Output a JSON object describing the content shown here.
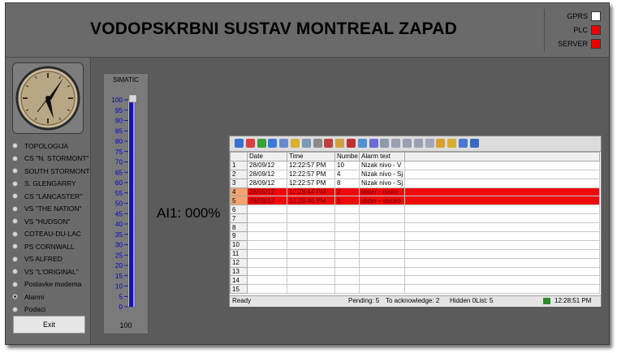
{
  "header": {
    "title": "VODOPSKRBNI SUSTAV MONTREAL ZAPAD"
  },
  "status": [
    {
      "label": "GPRS",
      "color": "#ffffff"
    },
    {
      "label": "PLC",
      "color": "#ee0000"
    },
    {
      "label": "SERVER",
      "color": "#ee0000"
    }
  ],
  "nav": {
    "items": [
      {
        "label": "TOPOLOGIJA",
        "selected": false
      },
      {
        "label": "CS \"N. STORMONT\"",
        "selected": false
      },
      {
        "label": "SOUTH STORMONT",
        "selected": false
      },
      {
        "label": "S. GLENGARRY",
        "selected": false
      },
      {
        "label": "CS \"LANCASTER\"",
        "selected": false
      },
      {
        "label": "VS \"THE NATION\"",
        "selected": false
      },
      {
        "label": "VS \"HUDSON\"",
        "selected": false
      },
      {
        "label": "COTEAU-DU-LAC",
        "selected": false
      },
      {
        "label": "PS CORNWALL",
        "selected": false
      },
      {
        "label": "VS ALFRED",
        "selected": false
      },
      {
        "label": "VS \"L'ORIGINAL\"",
        "selected": false
      },
      {
        "label": "Postavke modema",
        "selected": false
      },
      {
        "label": "Alarmi",
        "selected": true
      },
      {
        "label": "Podaci",
        "selected": false
      }
    ],
    "exit_label": "Exit"
  },
  "gauge": {
    "title": "SIMATIC",
    "ticks": [
      "100",
      "95",
      "90",
      "85",
      "80",
      "75",
      "70",
      "65",
      "60",
      "55",
      "50",
      "45",
      "40",
      "35",
      "30",
      "25",
      "20",
      "15",
      "10",
      "5",
      "0"
    ],
    "bottom_value": "100",
    "level_fraction": 1.0
  },
  "ai1": {
    "label": "AI1:",
    "value": "000%"
  },
  "alarm": {
    "toolbar_icons": [
      "help-icon",
      "first-icon",
      "loop-icon",
      "single-ack-icon",
      "group-ack-icon",
      "lock-icon",
      "history-icon",
      "filter-icon",
      "list-icon",
      "visible-icon",
      "hidden-icon",
      "print-icon",
      "sort-icon",
      "export-icon",
      "autoscroll-icon",
      "up-icon",
      "down-icon",
      "report-icon",
      "comment-icon",
      "lock2-icon",
      "settings-icon",
      "time-icon"
    ],
    "columns": [
      "Date",
      "Time",
      "Numbe",
      "Alarm text"
    ],
    "rows": [
      {
        "n": "1",
        "date": "28/09/12",
        "time": "12:22:57 PM",
        "num": "10",
        "text": "Nizak nivo - V",
        "red": false
      },
      {
        "n": "2",
        "date": "28/09/12",
        "time": "12:22:57 PM",
        "num": "4",
        "text": "Nizak nivo - Sj",
        "red": false
      },
      {
        "n": "3",
        "date": "28/09/12",
        "time": "12:22:57 PM",
        "num": "8",
        "text": "Nizak nivo - Sj",
        "red": false
      },
      {
        "n": "4",
        "date": "28/09/12",
        "time": "12:28:44 PM",
        "num": "2",
        "text": "slider - nisko",
        "red": true
      },
      {
        "n": "5",
        "date": "28/09/12",
        "time": "12:28:46 PM",
        "num": "1",
        "text": "slider - visoko",
        "red": true
      },
      {
        "n": "6",
        "date": "",
        "time": "",
        "num": "",
        "text": "",
        "red": false
      },
      {
        "n": "7",
        "date": "",
        "time": "",
        "num": "",
        "text": "",
        "red": false
      },
      {
        "n": "8",
        "date": "",
        "time": "",
        "num": "",
        "text": "",
        "red": false
      },
      {
        "n": "9",
        "date": "",
        "time": "",
        "num": "",
        "text": "",
        "red": false
      },
      {
        "n": "10",
        "date": "",
        "time": "",
        "num": "",
        "text": "",
        "red": false
      },
      {
        "n": "11",
        "date": "",
        "time": "",
        "num": "",
        "text": "",
        "red": false
      },
      {
        "n": "12",
        "date": "",
        "time": "",
        "num": "",
        "text": "",
        "red": false
      },
      {
        "n": "13",
        "date": "",
        "time": "",
        "num": "",
        "text": "",
        "red": false
      },
      {
        "n": "14",
        "date": "",
        "time": "",
        "num": "",
        "text": "",
        "red": false
      },
      {
        "n": "15",
        "date": "",
        "time": "",
        "num": "",
        "text": "",
        "red": false
      }
    ],
    "status": {
      "ready": "Ready",
      "pending": "Pending: 5",
      "to_ack": "To acknowledge: 2",
      "hidden": "Hidden 0",
      "list": "List: 5",
      "clock": "12:28:51 PM"
    }
  }
}
